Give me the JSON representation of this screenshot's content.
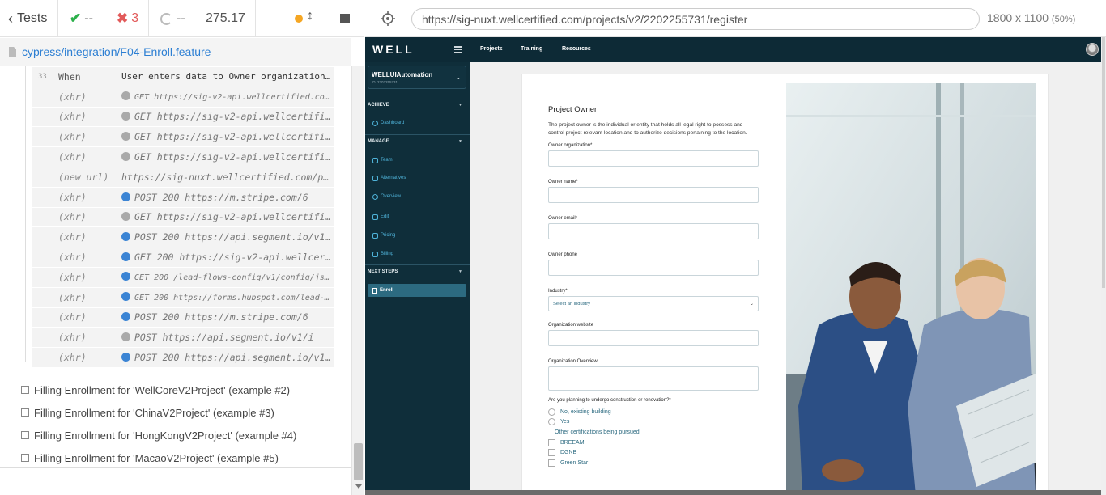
{
  "runner": {
    "tests_label": "Tests",
    "passed": "--",
    "failed": "3",
    "pending": "--",
    "duration": "275.17",
    "spec_path": "cypress/integration/F04-Enroll.feature"
  },
  "command_log": [
    {
      "num": "33",
      "name": "When",
      "msg": "User enters data to Owner organization, Owne...",
      "dot": "",
      "kind": "step"
    },
    {
      "num": "",
      "name": "(xhr)",
      "msg": "GET https://sig-v2-api.wellcertified.com/...",
      "dot": "gray",
      "kind": "small"
    },
    {
      "num": "",
      "name": "(xhr)",
      "msg": "GET https://sig-v2-api.wellcertifi...",
      "dot": "gray",
      "kind": "xhr"
    },
    {
      "num": "",
      "name": "(xhr)",
      "msg": "GET https://sig-v2-api.wellcertifi...",
      "dot": "gray",
      "kind": "xhr"
    },
    {
      "num": "",
      "name": "(xhr)",
      "msg": "GET https://sig-v2-api.wellcertifi...",
      "dot": "gray",
      "kind": "xhr"
    },
    {
      "num": "",
      "name": "(new url)",
      "msg": "https://sig-nuxt.wellcertified.com/pr...",
      "dot": "",
      "kind": "xhr"
    },
    {
      "num": "",
      "name": "(xhr)",
      "msg": "POST 200 https://m.stripe.com/6",
      "dot": "blue",
      "kind": "xhr"
    },
    {
      "num": "",
      "name": "(xhr)",
      "msg": "GET https://sig-v2-api.wellcertifi...",
      "dot": "gray",
      "kind": "xhr"
    },
    {
      "num": "",
      "name": "(xhr)",
      "msg": "POST 200 https://api.segment.io/v1...",
      "dot": "blue",
      "kind": "xhr"
    },
    {
      "num": "",
      "name": "(xhr)",
      "msg": "GET 200 https://sig-v2-api.wellcer...",
      "dot": "blue",
      "kind": "xhr"
    },
    {
      "num": "",
      "name": "(xhr)",
      "msg": "GET 200 /lead-flows-config/v1/config/json...",
      "dot": "blue",
      "kind": "small"
    },
    {
      "num": "",
      "name": "(xhr)",
      "msg": "GET 200 https://forms.hubspot.com/lead-fl...",
      "dot": "blue",
      "kind": "small"
    },
    {
      "num": "",
      "name": "(xhr)",
      "msg": "POST 200 https://m.stripe.com/6",
      "dot": "blue",
      "kind": "xhr"
    },
    {
      "num": "",
      "name": "(xhr)",
      "msg": "POST https://api.segment.io/v1/i",
      "dot": "gray",
      "kind": "xhr"
    },
    {
      "num": "",
      "name": "(xhr)",
      "msg": "POST 200 https://api.segment.io/v1...",
      "dot": "blue",
      "kind": "xhr"
    }
  ],
  "tests": [
    "Filling Enrollment for 'WellCoreV2Project' (example #2)",
    "Filling Enrollment for 'ChinaV2Project' (example #3)",
    "Filling Enrollment for 'HongKongV2Project' (example #4)",
    "Filling Enrollment for 'MacaoV2Project' (example #5)"
  ],
  "browser": {
    "url": "https://sig-nuxt.wellcertified.com/projects/v2/2202255731/register",
    "viewport": "1800 x 1100",
    "scale": "(50%)"
  },
  "app": {
    "brand": "WELL",
    "nav": [
      "Projects",
      "Training",
      "Resources"
    ],
    "org_name": "WELLUIAutomation",
    "org_id": "ID: 2202255731",
    "sections": {
      "achieve": "ACHIEVE",
      "manage": "MANAGE",
      "next_steps": "NEXT STEPS"
    },
    "achieve_items": [
      "Dashboard"
    ],
    "manage_items": [
      "Team",
      "Alternatives",
      "Overview",
      "Edit",
      "Pricing",
      "Billing"
    ],
    "enroll": "Enroll"
  },
  "form": {
    "title": "Project Owner",
    "description": "The project owner is the individual or entity that holds all legal right to possess and control project-relevant location and to authorize decisions pertaining to the location.",
    "owner_org_label": "Owner organization*",
    "owner_name_label": "Owner name*",
    "owner_email_label": "Owner email*",
    "owner_phone_label": "Owner phone",
    "industry_label": "Industry*",
    "industry_placeholder": "Select an industry",
    "org_website_label": "Organization website",
    "org_overview_label": "Organization Overview",
    "construction_question": "Are you planning to undergo construction or renovation?*",
    "options": [
      "No, existing building",
      "Yes"
    ],
    "other_cert_label": "Other certifications being pursued",
    "certs": [
      "BREEAM",
      "DGNB",
      "Green Star"
    ]
  },
  "colors": {
    "link_blue": "#2d7fd3",
    "fail_red": "#e25a5a",
    "pass_green": "#2bb04a",
    "nav_dark": "#0d2a36",
    "accent_teal": "#2c6a80"
  }
}
